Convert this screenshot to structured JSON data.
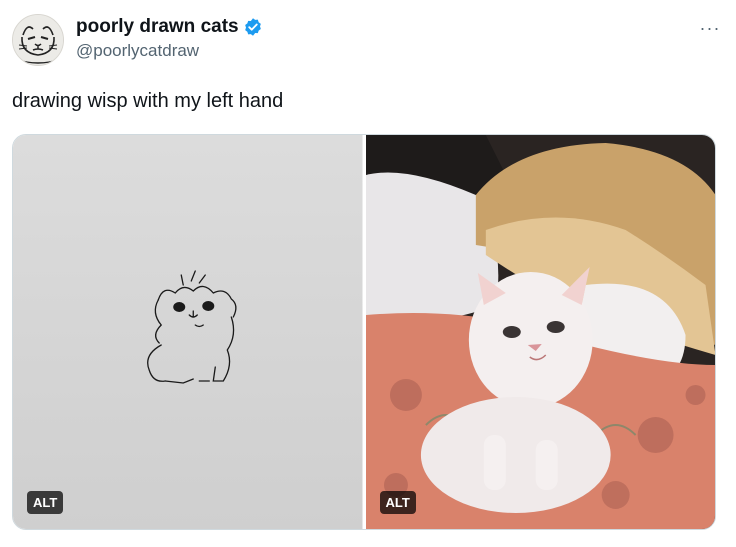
{
  "author": {
    "display_name": "poorly drawn cats",
    "handle": "@poorlycatdraw",
    "verified_icon": "verified-badge-icon"
  },
  "menu": {
    "more_label": "···"
  },
  "tweet": {
    "text": "drawing wisp with my left hand"
  },
  "media": [
    {
      "alt_label": "ALT"
    },
    {
      "alt_label": "ALT"
    }
  ],
  "colors": {
    "verified": "#1d9bf0",
    "secondary_text": "#536471",
    "border": "#cfd9de"
  }
}
